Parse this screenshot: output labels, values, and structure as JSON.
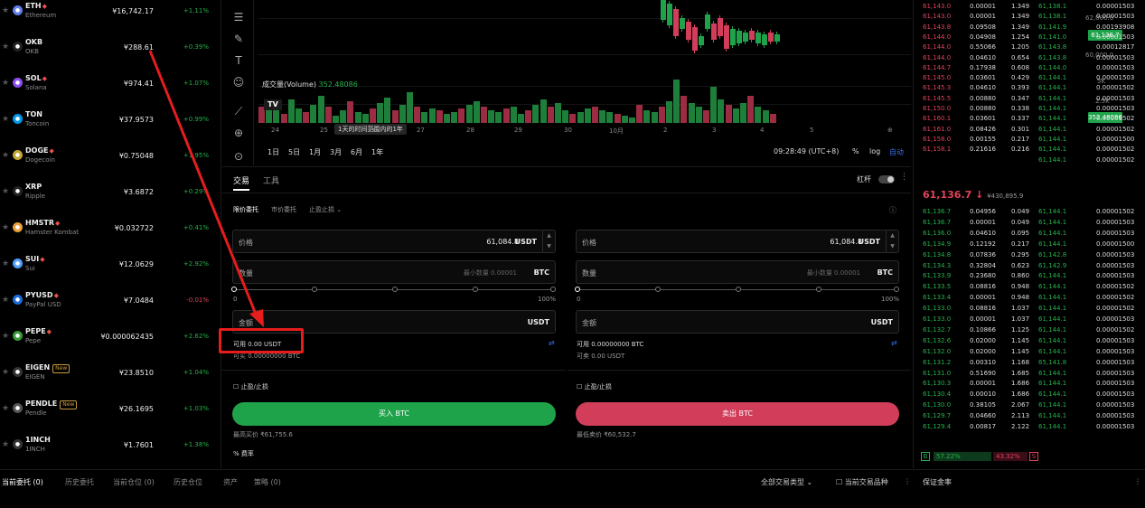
{
  "market": [
    {
      "sym": "ETH",
      "name": "Ethereum",
      "price": "¥16,742.17",
      "chg": "+1.11%",
      "dir": "up",
      "fire": true,
      "new": false,
      "color": "#627eea",
      "icon": "eth-icon"
    },
    {
      "sym": "OKB",
      "name": "OKB",
      "price": "¥288.61",
      "chg": "+0.39%",
      "dir": "up",
      "fire": false,
      "new": false,
      "color": "#222",
      "icon": "okb-icon"
    },
    {
      "sym": "SOL",
      "name": "Solana",
      "price": "¥974.41",
      "chg": "+1.07%",
      "dir": "up",
      "fire": true,
      "new": false,
      "color": "#8d4ef0",
      "icon": "sol-icon"
    },
    {
      "sym": "TON",
      "name": "Toncoin",
      "price": "¥37.9573",
      "chg": "+0.99%",
      "dir": "up",
      "fire": false,
      "new": false,
      "color": "#0098ea",
      "icon": "ton-icon"
    },
    {
      "sym": "DOGE",
      "name": "Dogecoin",
      "price": "¥0.75048",
      "chg": "+1.95%",
      "dir": "up",
      "fire": true,
      "new": false,
      "color": "#c2a633",
      "icon": "doge-icon"
    },
    {
      "sym": "XRP",
      "name": "Ripple",
      "price": "¥3.6872",
      "chg": "+0.29%",
      "dir": "up",
      "fire": false,
      "new": false,
      "color": "#222",
      "icon": "xrp-icon"
    },
    {
      "sym": "HMSTR",
      "name": "Hamster Kombat",
      "price": "¥0.032722",
      "chg": "+0.41%",
      "dir": "up",
      "fire": true,
      "new": false,
      "color": "#e8a03a",
      "icon": "hmstr-icon"
    },
    {
      "sym": "SUI",
      "name": "Sui",
      "price": "¥12.0629",
      "chg": "+2.92%",
      "dir": "up",
      "fire": true,
      "new": false,
      "color": "#4da2ff",
      "icon": "sui-icon"
    },
    {
      "sym": "PYUSD",
      "name": "PayPal USD",
      "price": "¥7.0484",
      "chg": "-0.01%",
      "dir": "down",
      "fire": true,
      "new": false,
      "color": "#1a6bd8",
      "icon": "pyusd-icon"
    },
    {
      "sym": "PEPE",
      "name": "Pepe",
      "price": "¥0.000062435",
      "chg": "+2.62%",
      "dir": "up",
      "fire": true,
      "new": false,
      "color": "#3a9b3a",
      "icon": "pepe-icon"
    },
    {
      "sym": "EIGEN",
      "name": "EIGEN",
      "price": "¥23.8510",
      "chg": "+1.04%",
      "dir": "up",
      "fire": false,
      "new": true,
      "color": "#333",
      "icon": "eigen-icon"
    },
    {
      "sym": "PENDLE",
      "name": "Pendle",
      "price": "¥26.1695",
      "chg": "+1.03%",
      "dir": "up",
      "fire": false,
      "new": true,
      "color": "#555",
      "icon": "pendle-icon"
    },
    {
      "sym": "1INCH",
      "name": "1INCH",
      "price": "¥1.7601",
      "chg": "+1.38%",
      "dir": "up",
      "fire": false,
      "new": false,
      "color": "#333",
      "icon": "1inch-icon"
    }
  ],
  "new_badge": "New",
  "chart": {
    "volume_label": "成交量(Volume)",
    "volume_value": "352.48086",
    "y_labels": [
      "62,000.0",
      "60,000.0"
    ],
    "vol_labels": [
      "5K",
      "2.5K"
    ],
    "last_price": "61,136.7",
    "last_vol": "352.48086",
    "x_ticks": [
      "24",
      "25",
      "26",
      "27",
      "28",
      "29",
      "30",
      "10月",
      "2",
      "3",
      "4",
      "5"
    ],
    "tooltip": "1天的时间范围内的1年",
    "ranges": [
      "1日",
      "5日",
      "1月",
      "3月",
      "6月",
      "1年"
    ],
    "time": "09:28:49 (UTC+8)",
    "pct": "%",
    "log": "log",
    "auto": "自动"
  },
  "trade": {
    "tabs": [
      "交易",
      "工具"
    ],
    "leverage": "杠杆",
    "order_types": [
      "限价委托",
      "市价委托",
      "止盈止损"
    ],
    "buy": {
      "price_label": "价格",
      "price": "61,084.8",
      "price_unit": "USDT",
      "qty_label": "数量",
      "qty_ph": "最小数量 0.00001",
      "qty_unit": "BTC",
      "total_label": "金额",
      "total_unit": "USDT",
      "slider_min": "0",
      "slider_max": "100%",
      "avail": "可用 0.00 USDT",
      "avail2": "可买 0.00000000 BTC",
      "tpsl": "止盈/止损",
      "btn": "买入 BTC",
      "max": "最高买价 ₹61,755.6",
      "fee": "费率"
    },
    "sell": {
      "price_label": "价格",
      "price": "61,084.8",
      "price_unit": "USDT",
      "qty_label": "数量",
      "qty_ph": "最小数量 0.00001",
      "qty_unit": "BTC",
      "total_label": "金额",
      "total_unit": "USDT",
      "slider_min": "0",
      "slider_max": "100%",
      "avail": "可用 0.00000000 BTC",
      "avail2": "可卖 0.00 USDT",
      "tpsl": "止盈/止损",
      "btn": "卖出 BTC",
      "min": "最低卖价 ₹60,532.7"
    }
  },
  "book": {
    "asks": [
      [
        "61,143.0",
        "0.00001",
        "1.349"
      ],
      [
        "61,143.0",
        "0.00001",
        "1.349"
      ],
      [
        "61,143.8",
        "0.09508",
        "1.349"
      ],
      [
        "61,144.0",
        "0.04908",
        "1.254"
      ],
      [
        "61,144.0",
        "0.55066",
        "1.205"
      ],
      [
        "61,144.0",
        "0.04610",
        "0.654"
      ],
      [
        "61,144.7",
        "0.17938",
        "0.608"
      ],
      [
        "61,145.0",
        "0.03601",
        "0.429"
      ],
      [
        "61,145.3",
        "0.04610",
        "0.393"
      ],
      [
        "61,145.5",
        "0.00880",
        "0.347"
      ],
      [
        "61,150.0",
        "0.00880",
        "0.338"
      ],
      [
        "61,160.1",
        "0.03601",
        "0.337"
      ],
      [
        "61,161.0",
        "0.08426",
        "0.301"
      ],
      [
        "61,158.0",
        "0.00155",
        "0.217"
      ],
      [
        "61,158.1",
        "0.21616",
        "0.216"
      ]
    ],
    "asks2": [
      [
        "61,138.1",
        "0.00001503"
      ],
      [
        "61,138.1",
        "0.00001503"
      ],
      [
        "61,141.9",
        "0.00193908"
      ],
      [
        "61,141.0",
        "0.00001503"
      ],
      [
        "61,143.8",
        "0.00012817"
      ],
      [
        "61,143.8",
        "0.00001503"
      ],
      [
        "61,144.0",
        "0.00001503"
      ],
      [
        "61,144.1",
        "0.00001503"
      ],
      [
        "61,144.1",
        "0.00001502"
      ],
      [
        "61,144.1",
        "0.00001503"
      ],
      [
        "61,144.1",
        "0.00001503"
      ],
      [
        "61,144.1",
        "0.00001502"
      ],
      [
        "61,144.1",
        "0.00001502"
      ],
      [
        "61,144.1",
        "0.00001500"
      ],
      [
        "61,144.1",
        "0.00001502"
      ],
      [
        "61,144.1",
        "0.00001502"
      ]
    ],
    "mid": "61,136.7",
    "mid_arrow": "↓",
    "mid_cny": "¥430,895.9",
    "bids": [
      [
        "61,136.7",
        "0.04956",
        "0.049"
      ],
      [
        "61,136.7",
        "0.00001",
        "0.049"
      ],
      [
        "61,136.0",
        "0.04610",
        "0.095"
      ],
      [
        "61,134.9",
        "0.12192",
        "0.217"
      ],
      [
        "61,134.8",
        "0.07836",
        "0.295"
      ],
      [
        "61,134.3",
        "0.32804",
        "0.623"
      ],
      [
        "61,133.9",
        "0.23680",
        "0.860"
      ],
      [
        "61,133.5",
        "0.08816",
        "0.948"
      ],
      [
        "61,133.4",
        "0.00001",
        "0.948"
      ],
      [
        "61,133.0",
        "0.08816",
        "1.037"
      ],
      [
        "61,133.0",
        "0.00001",
        "1.037"
      ],
      [
        "61,132.7",
        "0.10866",
        "1.125"
      ],
      [
        "61,132.6",
        "0.02000",
        "1.145"
      ],
      [
        "61,132.0",
        "0.02000",
        "1.145"
      ],
      [
        "61,131.2",
        "0.00310",
        "1.168"
      ],
      [
        "61,131.0",
        "0.51690",
        "1.685"
      ],
      [
        "61,130.3",
        "0.00001",
        "1.686"
      ],
      [
        "61,130.4",
        "0.00010",
        "1.686"
      ],
      [
        "61,130.0",
        "0.38105",
        "2.067"
      ],
      [
        "61,129.7",
        "0.04660",
        "2.113"
      ],
      [
        "61,129.4",
        "0.00817",
        "2.122"
      ]
    ],
    "bids2": [
      [
        "61,144.1",
        "0.00001502"
      ],
      [
        "61,144.1",
        "0.00001503"
      ],
      [
        "61,144.1",
        "0.00001503"
      ],
      [
        "61,144.1",
        "0.00001500"
      ],
      [
        "61,142.8",
        "0.00001503"
      ],
      [
        "61,142.9",
        "0.00001503"
      ],
      [
        "61,144.1",
        "0.00001503"
      ],
      [
        "61,144.1",
        "0.00001502"
      ],
      [
        "61,144.1",
        "0.00001502"
      ],
      [
        "61,144.1",
        "0.00001502"
      ],
      [
        "61,144.1",
        "0.00001503"
      ],
      [
        "61,144.1",
        "0.00001502"
      ],
      [
        "61,144.1",
        "0.00001503"
      ],
      [
        "61,144.1",
        "0.00001503"
      ],
      [
        "65,141.8",
        "0.00001503"
      ],
      [
        "61,144.1",
        "0.00001503"
      ],
      [
        "61,144.1",
        "0.00001503"
      ],
      [
        "61,144.1",
        "0.00001503"
      ],
      [
        "61,144.1",
        "0.00001503"
      ],
      [
        "61,144.1",
        "0.00001503"
      ],
      [
        "61,144.1",
        "0.00001503"
      ]
    ],
    "buy_pct": "57.22%",
    "sell_pct": "43.32%",
    "b": "B",
    "s": "S"
  },
  "bottom": {
    "tabs": [
      "当前委托 (0)",
      "历史委托",
      "当前仓位 (0)",
      "历史仓位",
      "资产",
      "策略 (0)"
    ],
    "filter": "全部交易类型",
    "only": "当前交易品种",
    "right": "保证金率"
  },
  "colors": {
    "buy": "#1fa34a",
    "sell": "#d23d5a",
    "highlight": "#e51d1d",
    "accent": "#3a6df0"
  }
}
